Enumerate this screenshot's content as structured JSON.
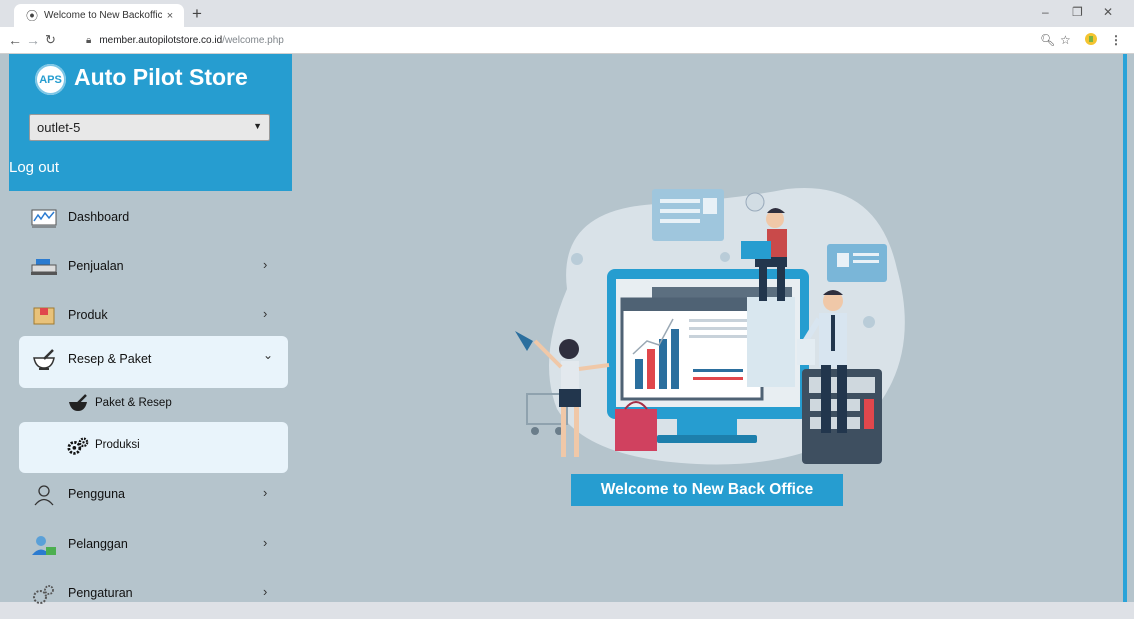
{
  "browser": {
    "tab_title": "Welcome to New Backoffice",
    "tab_close": "×",
    "new_tab": "+",
    "url_host": "member.autopilotstore.co.id",
    "url_path": "/welcome.php",
    "controls": {
      "minimize": "–",
      "restore": "❐",
      "close": "✕"
    }
  },
  "brand": {
    "logo_text": "APS",
    "name": "Auto Pilot Store"
  },
  "outlet_select": {
    "value": "outlet-5"
  },
  "logout_label": "Log out",
  "menu": {
    "dashboard": {
      "label": "Dashboard"
    },
    "penjualan": {
      "label": "Penjualan",
      "arrow": "›"
    },
    "produk": {
      "label": "Produk",
      "arrow": "›"
    },
    "resep_paket": {
      "label": "Resep & Paket",
      "arrow": "⌄"
    },
    "paket_resep": {
      "label": "Paket & Resep"
    },
    "produksi": {
      "label": "Produksi"
    },
    "pengguna": {
      "label": "Pengguna",
      "arrow": "›"
    },
    "pelanggan": {
      "label": "Pelanggan",
      "arrow": "›"
    },
    "pengaturan": {
      "label": "Pengaturan",
      "arrow": "›"
    }
  },
  "main": {
    "welcome_text": "Welcome to New Back Office"
  },
  "colors": {
    "brand_blue": "#269dd0",
    "content_bg": "#b5c4cc",
    "active_bg": "#e9f4fb"
  }
}
